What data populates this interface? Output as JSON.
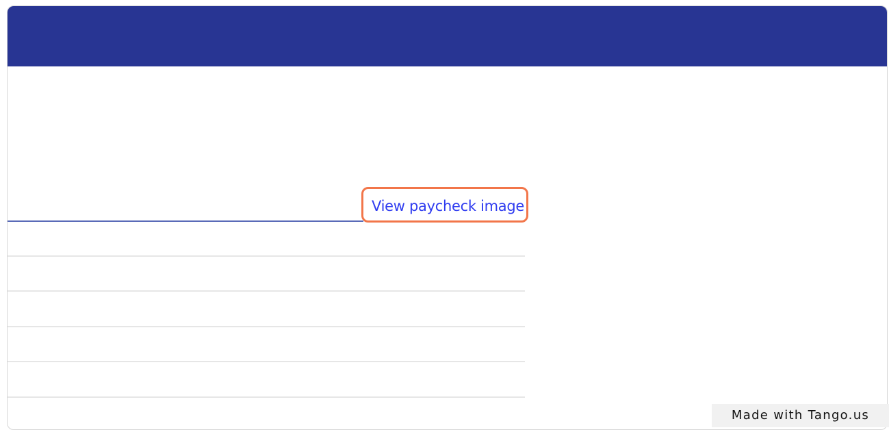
{
  "header": {
    "color": "#283593"
  },
  "content": {
    "link_label": "View paycheck image",
    "link_color": "#2f3cf0",
    "highlight_color": "#f2764a",
    "empty_rows": 5
  },
  "watermark": {
    "text": "Made with Tango.us"
  }
}
